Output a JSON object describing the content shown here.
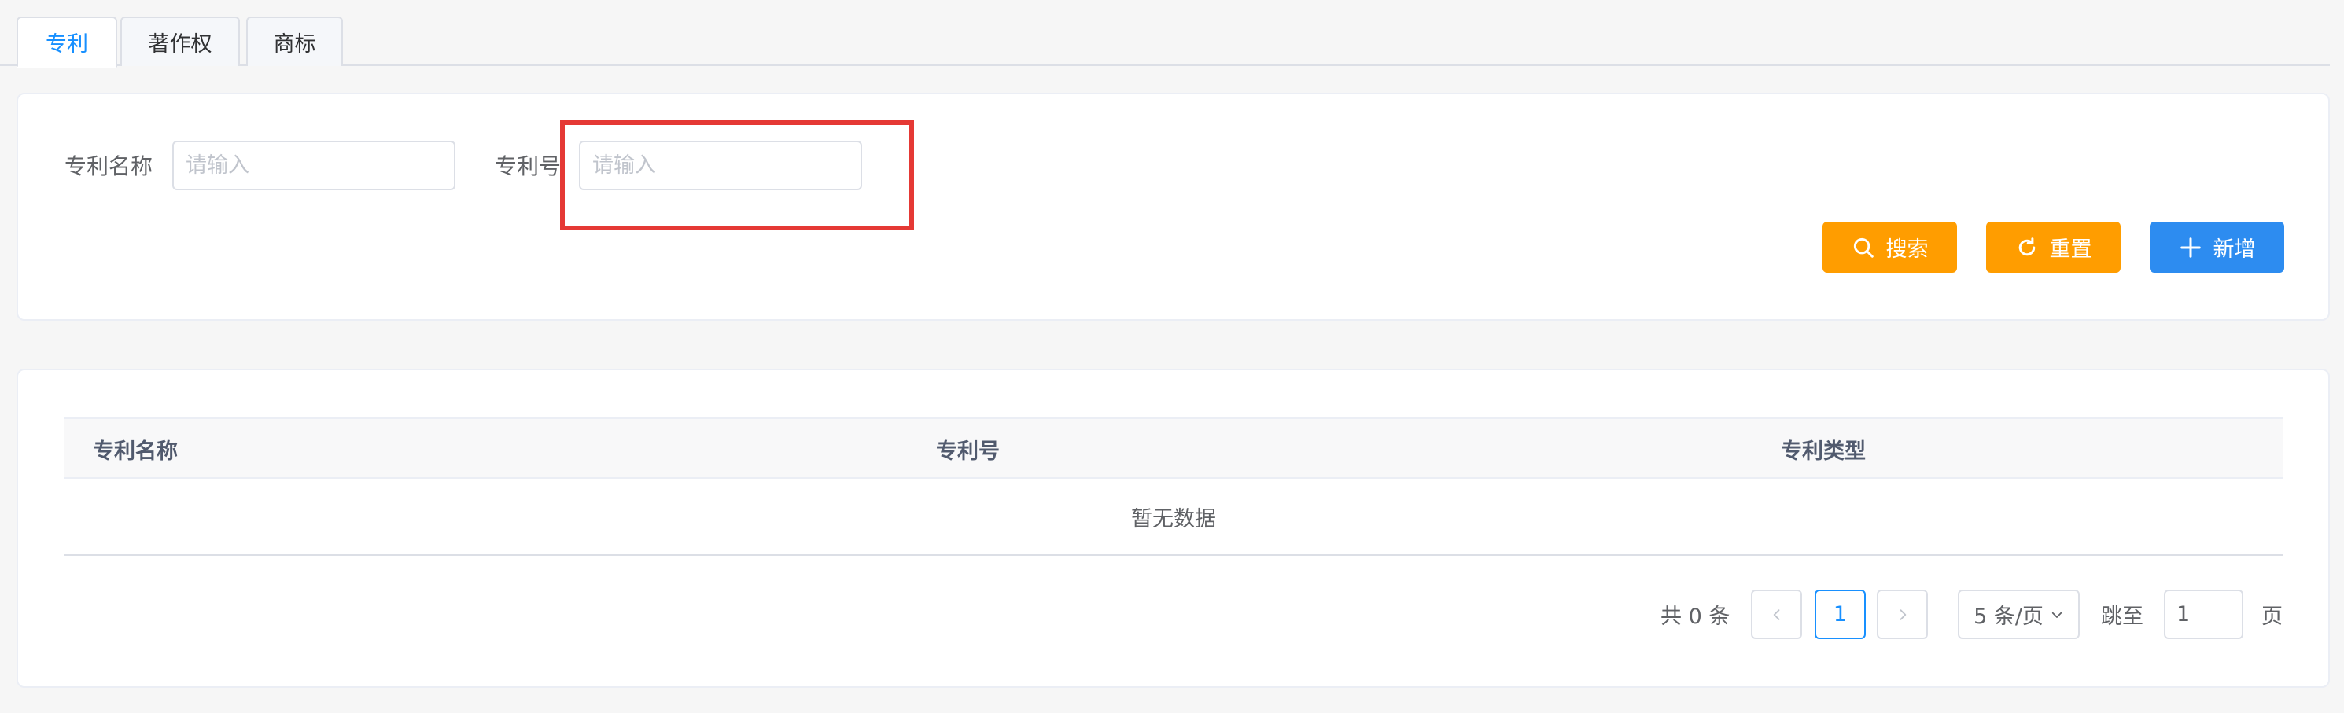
{
  "tabs": [
    {
      "label": "专利",
      "active": true
    },
    {
      "label": "著作权",
      "active": false
    },
    {
      "label": "商标",
      "active": false
    }
  ],
  "search": {
    "patent_name_label": "专利名称",
    "patent_name_placeholder": "请输入",
    "patent_no_label": "专利号",
    "patent_no_placeholder": "请输入",
    "search_button": "搜索",
    "reset_button": "重置",
    "add_button": "新增"
  },
  "table": {
    "columns": [
      "专利名称",
      "专利号",
      "专利类型"
    ],
    "empty_text": "暂无数据"
  },
  "pagination": {
    "total_text": "共 0 条",
    "current_page": "1",
    "page_size": "5 条/页",
    "jump_label": "跳至",
    "jump_value": "1",
    "page_suffix": "页"
  },
  "colors": {
    "accent": "#1890ff",
    "orange_button": "#ff9d00",
    "blue_button": "#2d8cf0",
    "highlight": "#e53935"
  }
}
